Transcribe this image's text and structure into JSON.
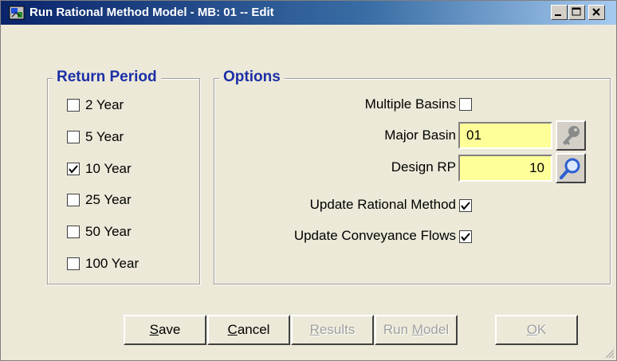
{
  "window": {
    "title": "Run Rational Method Model - MB: 01 -- Edit"
  },
  "return_period": {
    "legend": "Return Period",
    "items": [
      {
        "label": "2 Year",
        "checked": false
      },
      {
        "label": "5 Year",
        "checked": false
      },
      {
        "label": "10 Year",
        "checked": true
      },
      {
        "label": "25 Year",
        "checked": false
      },
      {
        "label": "50 Year",
        "checked": false
      },
      {
        "label": "100 Year",
        "checked": false
      }
    ]
  },
  "options": {
    "legend": "Options",
    "multiple_basins_label": "Multiple Basins",
    "multiple_basins_checked": false,
    "major_basin_label": "Major Basin",
    "major_basin_value": "01",
    "design_rp_label": "Design RP",
    "design_rp_value": "10",
    "update_rational_label": "Update Rational Method",
    "update_rational_checked": true,
    "update_conveyance_label": "Update Conveyance Flows",
    "update_conveyance_checked": true
  },
  "buttons": {
    "save": {
      "mnemonic": "S",
      "rest": "ave",
      "enabled": true
    },
    "cancel": {
      "mnemonic": "C",
      "rest": "ancel",
      "enabled": true
    },
    "results": {
      "mnemonic": "R",
      "rest": "esults",
      "enabled": false
    },
    "run_model": {
      "pre": "Run ",
      "mnemonic": "M",
      "rest": "odel",
      "enabled": false
    },
    "ok": {
      "mnemonic": "O",
      "rest": "K",
      "enabled": false
    }
  },
  "colors": {
    "title_start": "#0a246a",
    "legend": "#1c2fa7",
    "field_bg": "#ffff99",
    "dialog_bg": "#ece9d8"
  },
  "icons": [
    "app-icon",
    "minimize-icon",
    "maximize-icon",
    "close-icon",
    "key-icon",
    "magnifier-icon",
    "checkmark-icon",
    "resize-grip-icon"
  ]
}
